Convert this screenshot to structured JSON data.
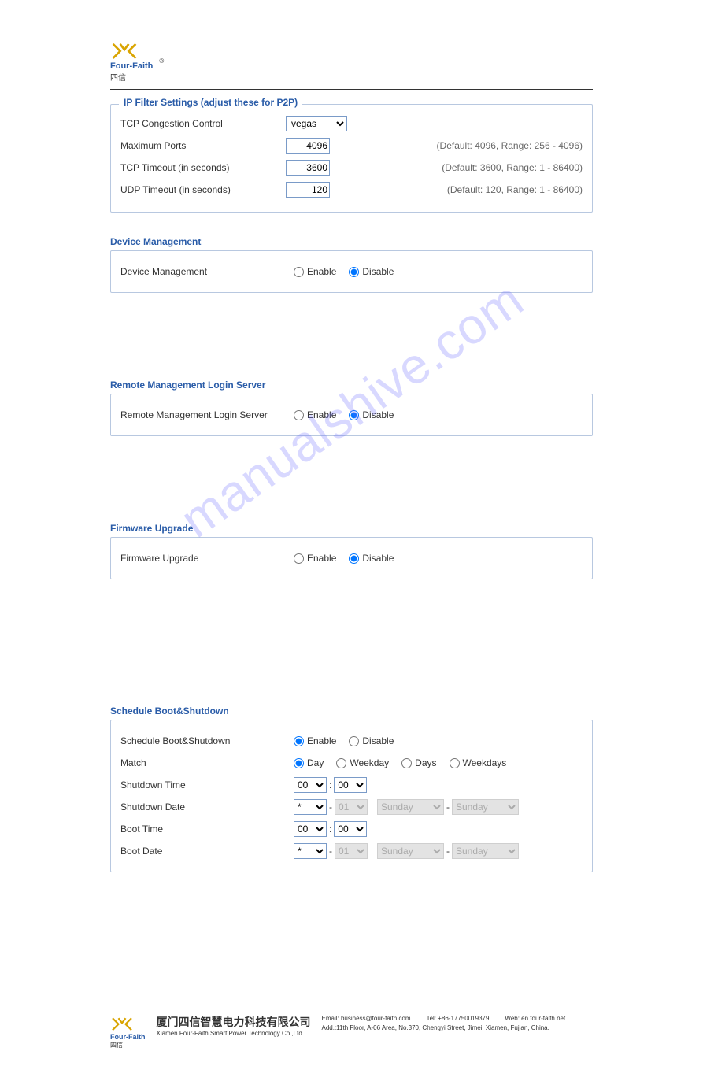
{
  "brand": {
    "name": "Four-Faith",
    "sub": "四信"
  },
  "ipFilter": {
    "legend": "IP Filter Settings (adjust these for P2P)",
    "tcpCongestionLabel": "TCP Congestion Control",
    "tcpCongestionValue": "vegas",
    "maxPortsLabel": "Maximum Ports",
    "maxPortsValue": "4096",
    "maxPortsHint": "(Default: 4096, Range: 256 - 4096)",
    "tcpTimeoutLabel": "TCP Timeout (in seconds)",
    "tcpTimeoutValue": "3600",
    "tcpTimeoutHint": "(Default: 3600, Range: 1 - 86400)",
    "udpTimeoutLabel": "UDP Timeout (in seconds)",
    "udpTimeoutValue": "120",
    "udpTimeoutHint": "(Default: 120, Range: 1 - 86400)"
  },
  "deviceManagement": {
    "title": "Device Management",
    "label": "Device Management",
    "enable": "Enable",
    "disable": "Disable",
    "selected": "disable"
  },
  "remoteLogin": {
    "title": "Remote Management Login Server",
    "label": "Remote Management Login Server",
    "enable": "Enable",
    "disable": "Disable",
    "selected": "disable"
  },
  "firmware": {
    "title": "Firmware Upgrade",
    "label": "Firmware Upgrade",
    "enable": "Enable",
    "disable": "Disable",
    "selected": "disable"
  },
  "schedule": {
    "title": "Schedule Boot&Shutdown",
    "rowLabel": "Schedule Boot&Shutdown",
    "enable": "Enable",
    "disable": "Disable",
    "scheduleSelected": "enable",
    "matchLabel": "Match",
    "matchOptions": {
      "day": "Day",
      "weekday": "Weekday",
      "days": "Days",
      "weekdays": "Weekdays"
    },
    "matchSelected": "day",
    "shutdownTimeLabel": "Shutdown Time",
    "shutdownTime": {
      "hh": "00",
      "mm": "00"
    },
    "shutdownDateLabel": "Shutdown Date",
    "shutdownDate": {
      "month": "*",
      "day": "01",
      "wd1": "Sunday",
      "wd2": "Sunday"
    },
    "bootTimeLabel": "Boot Time",
    "bootTime": {
      "hh": "00",
      "mm": "00"
    },
    "bootDateLabel": "Boot Date",
    "bootDate": {
      "month": "*",
      "day": "01",
      "wd1": "Sunday",
      "wd2": "Sunday"
    }
  },
  "watermark": "manualshive.com",
  "footer": {
    "companyCn": "厦门四信智慧电力科技有限公司",
    "companyEn": "Xiamen Four-Faith Smart Power Technology Co.,Ltd.",
    "email": "Email: business@four-faith.com",
    "tel": "Tel: +86-17750019379",
    "web": "Web: en.four-faith.net",
    "addr": "Add.:11th Floor, A-06 Area, No.370, Chengyi Street, Jimei, Xiamen, Fujian, China."
  }
}
